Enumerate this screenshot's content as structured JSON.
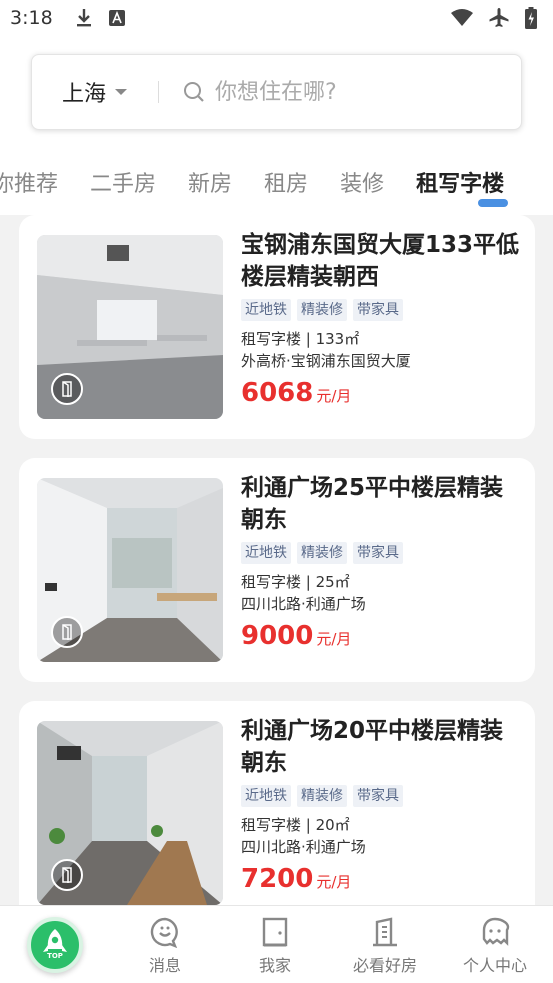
{
  "status_bar": {
    "time": "3:18",
    "icons": [
      "download-icon",
      "a-icon",
      "wifi-icon",
      "airplane-icon",
      "battery-icon"
    ]
  },
  "search": {
    "city": "上海",
    "placeholder": "你想住在哪?"
  },
  "tabs": [
    "你推荐",
    "二手房",
    "新房",
    "租房",
    "装修",
    "租写字楼"
  ],
  "active_tab": "租写字楼",
  "listings": [
    {
      "title": "宝钢浦东国贸大厦133平低楼层精装朝西",
      "tags": [
        "近地铁",
        "精装修",
        "带家具"
      ],
      "meta": "租写字楼 | 133㎡",
      "location": "外高桥·宝钢浦东国贸大厦",
      "price": "6068",
      "price_unit": "元/月"
    },
    {
      "title": "利通广场25平中楼层精装朝东",
      "tags": [
        "近地铁",
        "精装修",
        "带家具"
      ],
      "meta": "租写字楼 | 25㎡",
      "location": "四川北路·利通广场",
      "price": "9000",
      "price_unit": "元/月"
    },
    {
      "title": "利通广场20平中楼层精装朝东",
      "tags": [
        "近地铁",
        "精装修",
        "带家具"
      ],
      "meta": "租写字楼 | 20㎡",
      "location": "四川北路·利通广场",
      "price": "7200",
      "price_unit": "元/月"
    }
  ],
  "bottom_nav": {
    "fab_label": "TOP",
    "items": [
      {
        "label": "消息",
        "icon": "message-icon"
      },
      {
        "label": "我家",
        "icon": "home-door-icon"
      },
      {
        "label": "必看好房",
        "icon": "building-icon"
      },
      {
        "label": "个人中心",
        "icon": "profile-icon"
      }
    ]
  },
  "colors": {
    "accent_price": "#e8302e",
    "tab_underline": "#4a90e2",
    "fab_green": "#2bbf6a"
  }
}
